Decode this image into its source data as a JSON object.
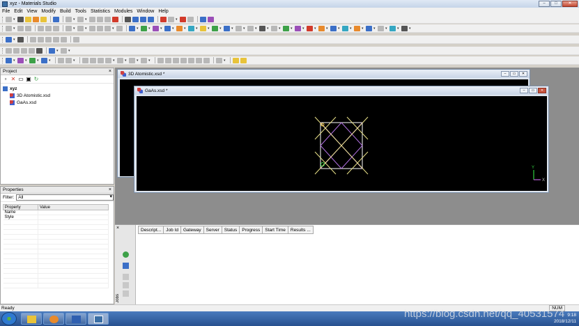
{
  "window": {
    "title": "xyz - Materials Studio"
  },
  "menu": [
    "File",
    "Edit",
    "View",
    "Modify",
    "Build",
    "Tools",
    "Statistics",
    "Modules",
    "Window",
    "Help"
  ],
  "project": {
    "header": "Project",
    "root": "xyz",
    "items": [
      "3D Atomistic.xsd",
      "GaAs.xsd"
    ]
  },
  "properties": {
    "header": "Properties",
    "filter_label": "Filter:",
    "filter_value": "All",
    "columns": [
      "Property",
      "Value"
    ],
    "rows": [
      "Name",
      "Style"
    ]
  },
  "documents": {
    "back": {
      "title": "3D Atomistic.xsd *"
    },
    "front": {
      "title": "GaAs.xsd *"
    }
  },
  "axes": {
    "y": "Y",
    "x": "X"
  },
  "jobs": {
    "columns": [
      "Descript...",
      "Job Id",
      "Gateway",
      "Server",
      "Status",
      "Progress",
      "Start Time",
      "Results ..."
    ],
    "side_label": "Jobs"
  },
  "status": {
    "left": "Ready",
    "num": "NUM"
  },
  "taskbar": {
    "time": "9:18",
    "date": "2018/12/11"
  },
  "watermark": "https://blog.csdn.net/qq_40531574",
  "colors": {
    "lattice_white": "#ffffff",
    "lattice_yellow": "#e8e088",
    "lattice_purple": "#b070e0",
    "axis_green": "#30d040",
    "axis_purple": "#c060e0"
  }
}
